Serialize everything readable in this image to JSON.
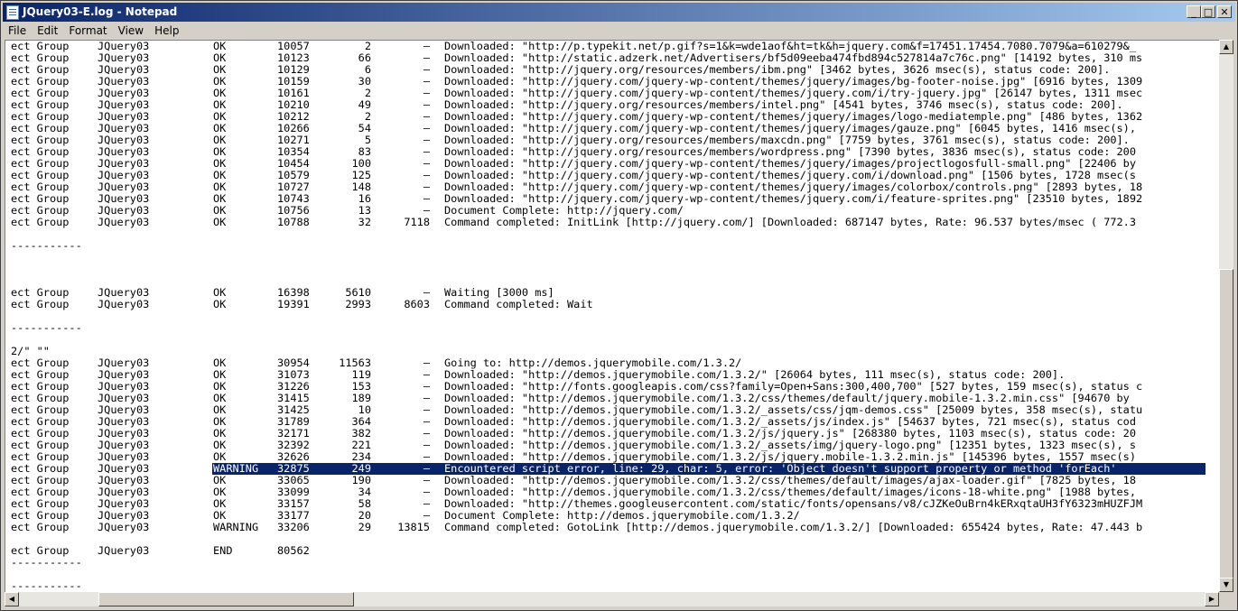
{
  "window": {
    "title": "JQuery03-E.log - Notepad",
    "minimize": "_",
    "maximize": "□",
    "close": "✕"
  },
  "menu": [
    "File",
    "Edit",
    "Format",
    "View",
    "Help"
  ],
  "log_lines": [
    {
      "a": "ect Group",
      "b": "JQuery03",
      "s": "OK",
      "t": "10057",
      "d": "2",
      "tot": "–",
      "msg": "Downloaded: \"http://p.typekit.net/p.gif?s=1&k=wde1aof&ht=tk&h=jquery.com&f=17451.17454.7080.7079&a=610279&_"
    },
    {
      "a": "ect Group",
      "b": "JQuery03",
      "s": "OK",
      "t": "10123",
      "d": "66",
      "tot": "–",
      "msg": "Downloaded: \"http://static.adzerk.net/Advertisers/bf5d09eeba474fbd894c527814a7c76c.png\" [14192 bytes, 310 ms"
    },
    {
      "a": "ect Group",
      "b": "JQuery03",
      "s": "OK",
      "t": "10129",
      "d": "6",
      "tot": "–",
      "msg": "Downloaded: \"http://jquery.org/resources/members/ibm.png\" [3462 bytes, 3626 msec(s), status code: 200]."
    },
    {
      "a": "ect Group",
      "b": "JQuery03",
      "s": "OK",
      "t": "10159",
      "d": "30",
      "tot": "–",
      "msg": "Downloaded: \"http://jquery.com/jquery-wp-content/themes/jquery/images/bg-footer-noise.jpg\" [6916 bytes, 1309"
    },
    {
      "a": "ect Group",
      "b": "JQuery03",
      "s": "OK",
      "t": "10161",
      "d": "2",
      "tot": "–",
      "msg": "Downloaded: \"http://jquery.com/jquery-wp-content/themes/jquery.com/i/try-jquery.jpg\" [26147 bytes, 1311 msec"
    },
    {
      "a": "ect Group",
      "b": "JQuery03",
      "s": "OK",
      "t": "10210",
      "d": "49",
      "tot": "–",
      "msg": "Downloaded: \"http://jquery.org/resources/members/intel.png\" [4541 bytes, 3746 msec(s), status code: 200]."
    },
    {
      "a": "ect Group",
      "b": "JQuery03",
      "s": "OK",
      "t": "10212",
      "d": "2",
      "tot": "–",
      "msg": "Downloaded: \"http://jquery.com/jquery-wp-content/themes/jquery/images/logo-mediatemple.png\" [486 bytes, 1362"
    },
    {
      "a": "ect Group",
      "b": "JQuery03",
      "s": "OK",
      "t": "10266",
      "d": "54",
      "tot": "–",
      "msg": "Downloaded: \"http://jquery.com/jquery-wp-content/themes/jquery/images/gauze.png\" [6045 bytes, 1416 msec(s),"
    },
    {
      "a": "ect Group",
      "b": "JQuery03",
      "s": "OK",
      "t": "10271",
      "d": "5",
      "tot": "–",
      "msg": "Downloaded: \"http://jquery.org/resources/members/maxcdn.png\" [7759 bytes, 3761 msec(s), status code: 200]."
    },
    {
      "a": "ect Group",
      "b": "JQuery03",
      "s": "OK",
      "t": "10354",
      "d": "83",
      "tot": "–",
      "msg": "Downloaded: \"http://jquery.org/resources/members/wordpress.png\" [7390 bytes, 3836 msec(s), status code: 200"
    },
    {
      "a": "ect Group",
      "b": "JQuery03",
      "s": "OK",
      "t": "10454",
      "d": "100",
      "tot": "–",
      "msg": "Downloaded: \"http://jquery.com/jquery-wp-content/themes/jquery/images/projectlogosfull-small.png\" [22406 by"
    },
    {
      "a": "ect Group",
      "b": "JQuery03",
      "s": "OK",
      "t": "10579",
      "d": "125",
      "tot": "–",
      "msg": "Downloaded: \"http://jquery.com/jquery-wp-content/themes/jquery.com/i/download.png\" [1506 bytes, 1728 msec(s"
    },
    {
      "a": "ect Group",
      "b": "JQuery03",
      "s": "OK",
      "t": "10727",
      "d": "148",
      "tot": "–",
      "msg": "Downloaded: \"http://jquery.com/jquery-wp-content/themes/jquery/images/colorbox/controls.png\" [2893 bytes, 18"
    },
    {
      "a": "ect Group",
      "b": "JQuery03",
      "s": "OK",
      "t": "10743",
      "d": "16",
      "tot": "–",
      "msg": "Downloaded: \"http://jquery.com/jquery-wp-content/themes/jquery.com/i/feature-sprites.png\" [23510 bytes, 1892"
    },
    {
      "a": "ect Group",
      "b": "JQuery03",
      "s": "OK",
      "t": "10756",
      "d": "13",
      "tot": "–",
      "msg": "Document Complete: http://jquery.com/"
    },
    {
      "a": "ect Group",
      "b": "JQuery03",
      "s": "OK",
      "t": "10788",
      "d": "32",
      "tot": "7118",
      "msg": "Command completed: InitLink [http://jquery.com/] [Downloaded: 687147 bytes, Rate: 96.537 bytes/msec ( 772.3"
    },
    {
      "plain": ""
    },
    {
      "plain": "-----------"
    },
    {
      "plain": ""
    },
    {
      "plain": ""
    },
    {
      "plain": ""
    },
    {
      "a": "ect Group",
      "b": "JQuery03",
      "s": "OK",
      "t": "16398",
      "d": "5610",
      "tot": "–",
      "msg": "Waiting [3000 ms]"
    },
    {
      "a": "ect Group",
      "b": "JQuery03",
      "s": "OK",
      "t": "19391",
      "d": "2993",
      "tot": "8603",
      "msg": "Command completed: Wait"
    },
    {
      "plain": ""
    },
    {
      "plain": "-----------"
    },
    {
      "plain": ""
    },
    {
      "plain": "2/\" \"\""
    },
    {
      "a": "ect Group",
      "b": "JQuery03",
      "s": "OK",
      "t": "30954",
      "d": "11563",
      "tot": "–",
      "msg": "Going to: http://demos.jquerymobile.com/1.3.2/"
    },
    {
      "a": "ect Group",
      "b": "JQuery03",
      "s": "OK",
      "t": "31073",
      "d": "119",
      "tot": "–",
      "msg": "Downloaded: \"http://demos.jquerymobile.com/1.3.2/\" [26064 bytes, 111 msec(s), status code: 200]."
    },
    {
      "a": "ect Group",
      "b": "JQuery03",
      "s": "OK",
      "t": "31226",
      "d": "153",
      "tot": "–",
      "msg": "Downloaded: \"http://fonts.googleapis.com/css?family=Open+Sans:300,400,700\" [527 bytes, 159 msec(s), status c"
    },
    {
      "a": "ect Group",
      "b": "JQuery03",
      "s": "OK",
      "t": "31415",
      "d": "189",
      "tot": "–",
      "msg": "Downloaded: \"http://demos.jquerymobile.com/1.3.2/css/themes/default/jquery.mobile-1.3.2.min.css\" [94670 by"
    },
    {
      "a": "ect Group",
      "b": "JQuery03",
      "s": "OK",
      "t": "31425",
      "d": "10",
      "tot": "–",
      "msg": "Downloaded: \"http://demos.jquerymobile.com/1.3.2/_assets/css/jqm-demos.css\" [25009 bytes, 358 msec(s), statu"
    },
    {
      "a": "ect Group",
      "b": "JQuery03",
      "s": "OK",
      "t": "31789",
      "d": "364",
      "tot": "–",
      "msg": "Downloaded: \"http://demos.jquerymobile.com/1.3.2/_assets/js/index.js\" [54637 bytes, 721 msec(s), status cod"
    },
    {
      "a": "ect Group",
      "b": "JQuery03",
      "s": "OK",
      "t": "32171",
      "d": "382",
      "tot": "–",
      "msg": "Downloaded: \"http://demos.jquerymobile.com/1.3.2/js/jquery.js\" [268380 bytes, 1103 msec(s), status code: 20"
    },
    {
      "a": "ect Group",
      "b": "JQuery03",
      "s": "OK",
      "t": "32392",
      "d": "221",
      "tot": "–",
      "msg": "Downloaded: \"http://demos.jquerymobile.com/1.3.2/_assets/img/jquery-logo.png\" [12351 bytes, 1323 msec(s), s"
    },
    {
      "a": "ect Group",
      "b": "JQuery03",
      "s": "OK",
      "t": "32626",
      "d": "234",
      "tot": "–",
      "msg": "Downloaded: \"http://demos.jquerymobile.com/1.3.2/js/jquery.mobile-1.3.2.min.js\" [145396 bytes, 1557 msec(s)"
    },
    {
      "a": "ect Group",
      "b": "JQuery03",
      "s": "WARNING",
      "t": "32875",
      "d": "249",
      "tot": "–",
      "msg": "Encountered script error, line: 29, char: 5, error: 'Object doesn't support property or method 'forEach'",
      "selected": true
    },
    {
      "a": "ect Group",
      "b": "JQuery03",
      "s": "OK",
      "t": "33065",
      "d": "190",
      "tot": "–",
      "msg": "Downloaded: \"http://demos.jquerymobile.com/1.3.2/css/themes/default/images/ajax-loader.gif\" [7825 bytes, 18"
    },
    {
      "a": "ect Group",
      "b": "JQuery03",
      "s": "OK",
      "t": "33099",
      "d": "34",
      "tot": "–",
      "msg": "Downloaded: \"http://demos.jquerymobile.com/1.3.2/css/themes/default/images/icons-18-white.png\" [1988 bytes,"
    },
    {
      "a": "ect Group",
      "b": "JQuery03",
      "s": "OK",
      "t": "33157",
      "d": "58",
      "tot": "–",
      "msg": "Downloaded: \"http://themes.googleusercontent.com/static/fonts/opensans/v8/cJZKeOuBrn4kERxqtaUH3fY6323mHUZFJM"
    },
    {
      "a": "ect Group",
      "b": "JQuery03",
      "s": "OK",
      "t": "33177",
      "d": "20",
      "tot": "–",
      "msg": "Document Complete: http://demos.jquerymobile.com/1.3.2/"
    },
    {
      "a": "ect Group",
      "b": "JQuery03",
      "s": "WARNING",
      "t": "33206",
      "d": "29",
      "tot": "13815",
      "msg": "Command completed: GotoLink [http://demos.jquerymobile.com/1.3.2/] [Downloaded: 655424 bytes, Rate: 47.443 b"
    },
    {
      "plain": ""
    },
    {
      "a": "ect Group",
      "b": "JQuery03",
      "s": "END",
      "t": "80562",
      "d": "",
      "tot": "",
      "msg": ""
    },
    {
      "plain": "-----------"
    },
    {
      "plain": ""
    },
    {
      "plain": "-----------"
    }
  ]
}
